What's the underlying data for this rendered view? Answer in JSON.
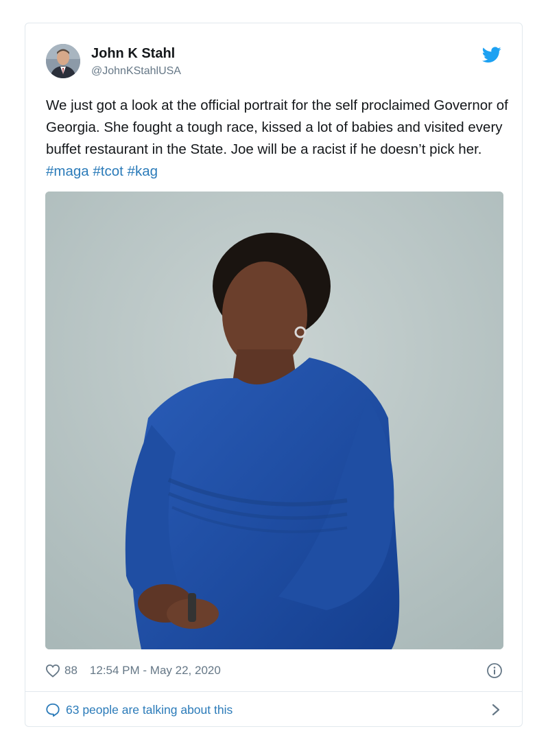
{
  "tweet": {
    "author_name": "John K Stahl",
    "author_handle": "@JohnKStahlUSA",
    "text_main": "We just got a look at the official portrait for the self proclaimed Governor of Georgia. She fought a tough race, kissed a lot of babies and visited every buffet restaurant in the State. Joe will be a racist if he doesn’t pick her. ",
    "hashtags": [
      "#maga",
      "#tcot",
      "#kag"
    ],
    "like_count": "88",
    "timestamp": "12:54 PM - May 22, 2020",
    "talking_text": "63 people are talking about this"
  },
  "icons": {
    "brand": "twitter-bird-icon",
    "like": "heart-icon",
    "info": "info-icon",
    "reply": "speech-bubble-icon",
    "more": "chevron-right-icon"
  },
  "colors": {
    "brand_blue": "#1da1f2",
    "link_blue": "#2b7bb9",
    "text_primary": "#14171a",
    "text_secondary": "#657786",
    "border": "#e1e8ed"
  }
}
